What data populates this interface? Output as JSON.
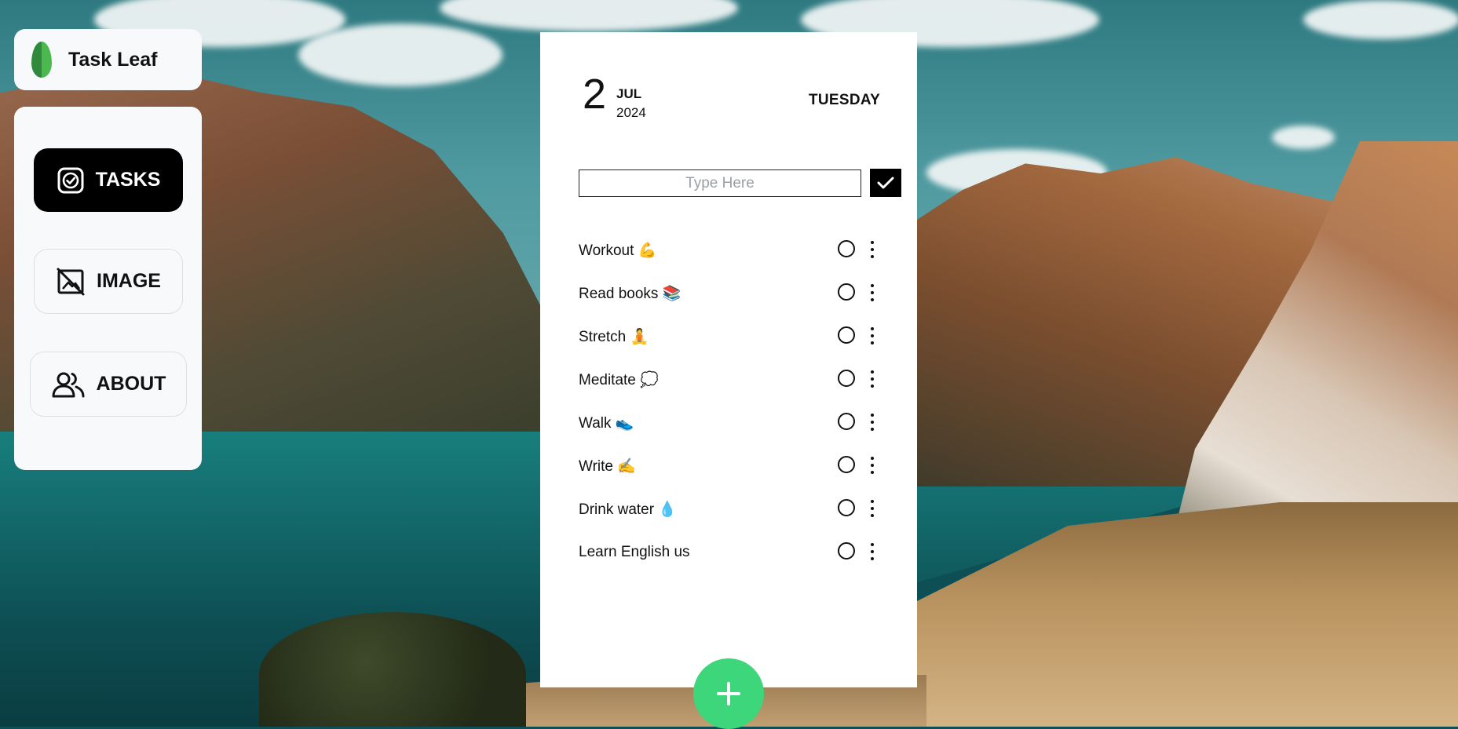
{
  "app": {
    "name": "Task Leaf"
  },
  "nav": {
    "items": [
      {
        "label": "TASKS",
        "icon": "check-square-icon",
        "active": true
      },
      {
        "label": "IMAGE",
        "icon": "image-off-icon",
        "active": false
      },
      {
        "label": "ABOUT",
        "icon": "users-icon",
        "active": false
      }
    ]
  },
  "date": {
    "day": "2",
    "month": "JUL",
    "year": "2024",
    "weekday": "TUESDAY"
  },
  "input": {
    "placeholder": "Type Here",
    "value": ""
  },
  "tasks": [
    {
      "text": "Workout 💪"
    },
    {
      "text": "Read books 📚"
    },
    {
      "text": "Stretch 🧘"
    },
    {
      "text": "Meditate 💭"
    },
    {
      "text": "Walk 👟"
    },
    {
      "text": "Write ✍️"
    },
    {
      "text": "Drink water 💧"
    },
    {
      "text": "Learn English us"
    }
  ],
  "colors": {
    "accent": "#3dd67a",
    "active_nav": "#000000",
    "card": "#f8f9fb",
    "leaf": "#4cb84f"
  },
  "fab": {
    "label": "+",
    "icon": "plus-icon"
  }
}
